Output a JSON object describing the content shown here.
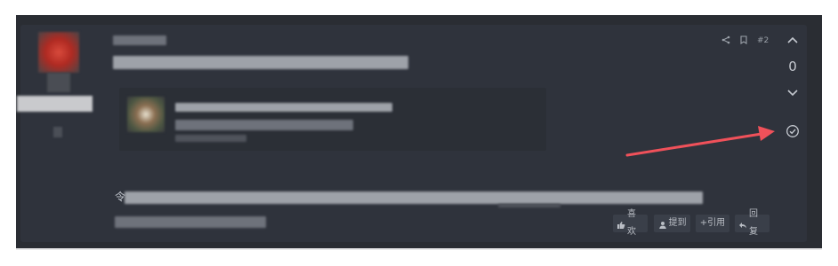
{
  "post": {
    "number": "#2",
    "vote_count": "0",
    "reply_prefix": "令"
  },
  "actions": {
    "like": "喜欢",
    "mention": "提到",
    "quote": "+引用",
    "reply": "回复"
  },
  "icons": {
    "share": "share-icon",
    "bookmark": "bookmark-icon",
    "upvote": "chevron-up-icon",
    "downvote": "chevron-down-icon",
    "accepted": "check-circle-icon"
  },
  "colors": {
    "page_bg": "#ffffff",
    "frame_bg": "#2a2d33",
    "card_bg": "#2f333c",
    "button_bg": "#3a3f49",
    "annotation_arrow": "#f0515a"
  }
}
